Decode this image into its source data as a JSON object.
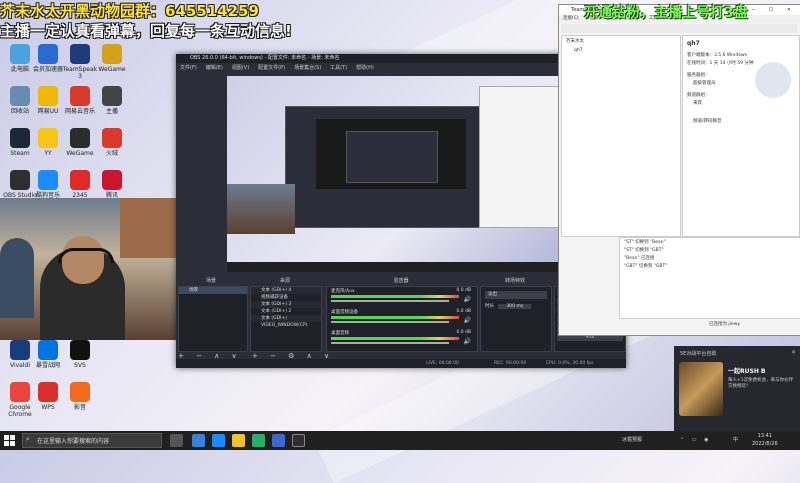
{
  "overlays": {
    "line1": "芥末水太开黑动物园群：645514259",
    "line2": "主播一定认真看弹幕，回复每一条互动信息!",
    "right": "开通钻粉，主播上号打3盘"
  },
  "desktop_icons": [
    {
      "label": "此电脑",
      "icon": "computer-icon",
      "color": "#4aa3df"
    },
    {
      "label": "会员加速器",
      "icon": "accelerator-icon",
      "color": "#2a6bd1"
    },
    {
      "label": "TeamSpeak 3",
      "icon": "teamspeak-icon",
      "color": "#1d3c78"
    },
    {
      "label": "WeGame",
      "icon": "wegame-icon",
      "color": "#d4a21a"
    },
    {
      "label": "回收站",
      "icon": "recycle-bin-icon",
      "color": "#6a8bb0"
    },
    {
      "label": "网易UU",
      "icon": "uu-icon",
      "color": "#f2b705"
    },
    {
      "label": "网易云音乐",
      "icon": "music-icon",
      "color": "#d63b2d"
    },
    {
      "label": "主播",
      "icon": "streamer-icon",
      "color": "#444"
    },
    {
      "label": "Steam",
      "icon": "steam-icon",
      "color": "#1b2838"
    },
    {
      "label": "YY",
      "icon": "yy-icon",
      "color": "#f5c518"
    },
    {
      "label": "WeGame",
      "icon": "wegame2-icon",
      "color": "#2c2c2c"
    },
    {
      "label": "火绒",
      "icon": "shield-icon",
      "color": "#d93a2b"
    },
    {
      "label": "OBS Studio",
      "icon": "obs-icon",
      "color": "#302e31"
    },
    {
      "label": "酷狗音乐",
      "icon": "kugou-icon",
      "color": "#1a8cff"
    },
    {
      "label": "2345",
      "icon": "browser-icon",
      "color": "#e02a2a"
    },
    {
      "label": "腾讯",
      "icon": "tencent-icon",
      "color": "#c9162e"
    },
    {
      "label": "Vivaldi",
      "icon": "vivaldi-icon",
      "color": "#1a3c78"
    },
    {
      "label": "暴雪战网",
      "icon": "battlenet-icon",
      "color": "#0074e0"
    },
    {
      "label": "SVS",
      "icon": "svs-icon",
      "color": "#111"
    },
    {
      "label": "Google Chrome",
      "icon": "chrome-icon",
      "color": "#e8453c"
    },
    {
      "label": "WPS",
      "icon": "wps-icon",
      "color": "#d9302c"
    },
    {
      "label": "影音",
      "icon": "video-icon",
      "color": "#f26a1b"
    }
  ],
  "obs": {
    "title": "OBS 26.0.0 (64-bit, windows) - 配置文件: 未命名 - 场景: 未命名",
    "menu": [
      "文件(F)",
      "编辑(E)",
      "视图(V)",
      "配置文件(P)",
      "场景集合(S)",
      "工具(T)",
      "帮助(H)"
    ],
    "panel_titles": {
      "scenes": "场景",
      "sources": "来源",
      "mixer": "混音器",
      "transitions": "转场特效",
      "controls": "控件"
    },
    "scenes_label": "场景",
    "sources": [
      "文本 (GDI+) 4",
      "视频捕获设备",
      "文本 (GDI+) 3",
      "文本 (GDI+) 2",
      "文本 (GDI+)",
      "VIDEO_WINDOW(CP)"
    ],
    "mixer": [
      {
        "name": "麦克风/Aux",
        "db": "0.0 dB"
      },
      {
        "name": "桌面音频设备",
        "db": "0.0 dB"
      },
      {
        "name": "桌面音频",
        "db": "0.0 dB"
      }
    ],
    "transitions": {
      "type": "淡出",
      "duration_label": "时长",
      "duration": "300 ms"
    },
    "controls": [
      "停止推流",
      "开始录制",
      "启动虚拟摄像机",
      "工作室模式",
      "设置",
      "退出"
    ],
    "status": {
      "live": "LIVE: 00:00:00",
      "rec": "REC: 00:00:00",
      "cpu": "CPU: 0.0%, 30.00 fps"
    }
  },
  "teamspeak": {
    "title": "TeamSpeak 3",
    "menu": [
      "连接(C)",
      "书签(B)",
      "自己(S)",
      "权限(P)",
      "工具(T)",
      "帮助(H)"
    ],
    "tree": [
      "芥末水太",
      "qh7"
    ],
    "info": {
      "name": "qh7",
      "version_label": "客户端版本：",
      "version": "3.5.6 Windows",
      "online_label": "在线时间：",
      "online": "1 天 14 小时 59 分钟",
      "group_label": "服务器组：",
      "group": "超级管理员",
      "channel_group_label": "频道群组：",
      "channel_group": "来宾",
      "channel_label": "频道/转码静音"
    },
    "chat": [
      "\"ST\" 切换到 \"Bean\"",
      "\"ST\" 切换到 \"GBT\"",
      "\"Bean\" 已连接",
      "\"GBT\" 切换到 \"GBT\""
    ],
    "footer": "已连接为 jiewy"
  },
  "notification": {
    "header": "5E对战平台自助",
    "title": "一起RUSH B",
    "body": "每人+1次免费机会，来与你伙伴交换畅玩！"
  },
  "taskbar": {
    "search": "在这里输入你要搜索的内容",
    "weather": "冰雹预报",
    "time": "13:41",
    "date": "2022/8/26",
    "lang": "中"
  }
}
